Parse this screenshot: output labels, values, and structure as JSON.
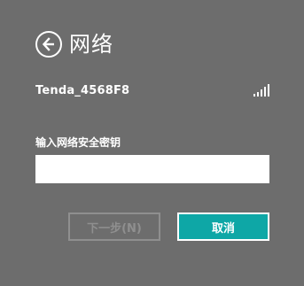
{
  "header": {
    "title": "网络",
    "back_icon": "back-arrow-circle-icon"
  },
  "network": {
    "ssid": "Tenda_4568F8",
    "signal_icon": "signal-strength-icon",
    "signal_bars": 5
  },
  "security_key": {
    "label": "输入网络安全密钥",
    "value": "",
    "placeholder": ""
  },
  "buttons": {
    "next_label": "下一步(N)",
    "next_enabled": false,
    "cancel_label": "取消"
  },
  "colors": {
    "background": "#6d6d6d",
    "accent": "#0ea7a6",
    "disabled": "#8f8f8f"
  }
}
